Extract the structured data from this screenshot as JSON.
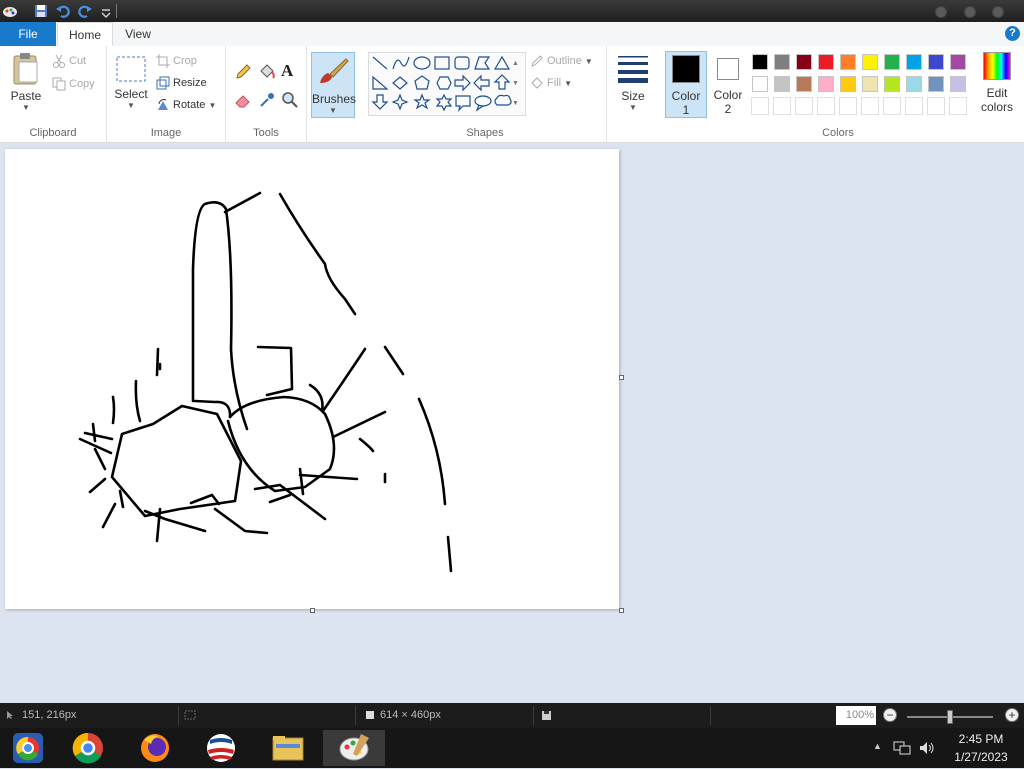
{
  "tabs": {
    "file": "File",
    "home": "Home",
    "view": "View",
    "help": "?"
  },
  "clipboard": {
    "paste": "Paste",
    "cut": "Cut",
    "copy": "Copy",
    "label": "Clipboard"
  },
  "image": {
    "select": "Select",
    "crop": "Crop",
    "resize": "Resize",
    "rotate": "Rotate",
    "label": "Image"
  },
  "tools": {
    "label": "Tools",
    "text_glyph": "A"
  },
  "brushes": {
    "label": "Brushes"
  },
  "shapes": {
    "label": "Shapes",
    "outline": "Outline",
    "fill": "Fill"
  },
  "size": {
    "label": "Size"
  },
  "color1": {
    "label": "Color",
    "num": "1",
    "value": "#000000"
  },
  "color2": {
    "label": "Color",
    "num": "2",
    "value": "#ffffff"
  },
  "colors": {
    "label": "Colors",
    "edit_line1": "Edit",
    "edit_line2": "colors",
    "row1": [
      "#000000",
      "#7f7f7f",
      "#880015",
      "#ed1c24",
      "#ff7f27",
      "#fff200",
      "#22b14c",
      "#00a2e8",
      "#3f48cc",
      "#a349a4"
    ],
    "row2": [
      "#ffffff",
      "#c3c3c3",
      "#b97a57",
      "#ffaec9",
      "#ffc90e",
      "#efe4b0",
      "#b5e61d",
      "#99d9ea",
      "#7092be",
      "#c8bfe7"
    ]
  },
  "status": {
    "cursor_pos": "151, 216px",
    "canvas_size": "614 × 460px",
    "zoom": "100%",
    "zoom_level": 0.5
  },
  "tray": {
    "time": "2:45 PM",
    "date": "1/27/2023"
  }
}
